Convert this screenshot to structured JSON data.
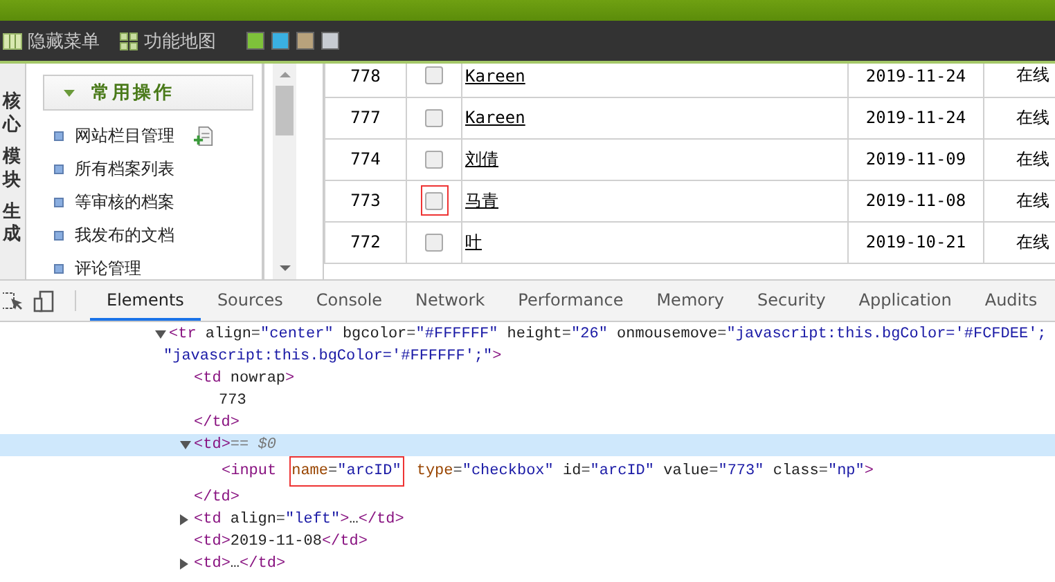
{
  "toolbar": {
    "items": [
      {
        "label": "隐藏菜单",
        "kind": "columns"
      },
      {
        "label": "功能地图",
        "kind": "grid"
      }
    ],
    "swatches": [
      {
        "color": "#7ec23a"
      },
      {
        "color": "#3ab0e2"
      },
      {
        "color": "#b8a27c"
      },
      {
        "color": "#c8ccd2"
      }
    ]
  },
  "side_tabs": [
    "核心",
    "模块",
    "生成"
  ],
  "sidebar": {
    "header": "常用操作",
    "expanded": true,
    "items": [
      {
        "label": "网站栏目管理",
        "has_add": true
      },
      {
        "label": "所有档案列表",
        "has_add": false
      },
      {
        "label": "等审核的档案",
        "has_add": false
      },
      {
        "label": "我发布的文档",
        "has_add": false
      },
      {
        "label": "评论管理",
        "has_add": false
      }
    ]
  },
  "table": {
    "rows": [
      {
        "id": "778",
        "checked": false,
        "highlighted": false,
        "title": "Kareen",
        "date": "2019-11-24",
        "status": "在线"
      },
      {
        "id": "777",
        "checked": false,
        "highlighted": false,
        "title": "Kareen",
        "date": "2019-11-24",
        "status": "在线"
      },
      {
        "id": "774",
        "checked": false,
        "highlighted": false,
        "title": "刘倩",
        "date": "2019-11-09",
        "status": "在线"
      },
      {
        "id": "773",
        "checked": false,
        "highlighted": true,
        "title": "马青",
        "date": "2019-11-08",
        "status": "在线"
      },
      {
        "id": "772",
        "checked": false,
        "highlighted": false,
        "title": "叶",
        "date": "2019-10-21",
        "status": "在线"
      }
    ]
  },
  "devtools": {
    "tabs": [
      {
        "label": "Elements",
        "selected": true
      },
      {
        "label": "Sources",
        "selected": false
      },
      {
        "label": "Console",
        "selected": false
      },
      {
        "label": "Network",
        "selected": false
      },
      {
        "label": "Performance",
        "selected": false
      },
      {
        "label": "Memory",
        "selected": false
      },
      {
        "label": "Security",
        "selected": false
      },
      {
        "label": "Application",
        "selected": false
      },
      {
        "label": "Audits",
        "selected": false
      }
    ],
    "tree": [
      {
        "lines": [
          "<tr align=\"center\" bgcolor=\"#FFFFFF\" height=\"26\" onmousemove=\"javascript:this.bgColor='#FCFDEE';",
          "\"javascript:this.bgColor='#FFFFFF';\">"
        ],
        "expanded": true,
        "selected": false,
        "children": [
          {
            "lines": [
              "<td nowrap>"
            ],
            "selected": false,
            "children": [
              {
                "lines": [
                  "773"
                ],
                "selected": false
              }
            ],
            "close": "</td>"
          },
          {
            "lines": [
              "<td>"
            ],
            "suffix": "== $0",
            "expanded": true,
            "selected": true,
            "children": [
              {
                "segments": [
                  {
                    "text": "<input",
                    "boxed": false
                  },
                  {
                    "text": "name=\"arcID\"",
                    "boxed": true
                  },
                  {
                    "text": "type=\"checkbox\" id=\"arcID\" value=\"773\" class=\"np\">",
                    "boxed": false
                  }
                ],
                "selected": false
              }
            ],
            "close": "</td>"
          },
          {
            "lines": [
              "<td align=\"left\">…</td>"
            ],
            "expanded": false,
            "selected": false
          },
          {
            "lines": [
              "<td>2019-11-08</td>"
            ],
            "selected": false
          },
          {
            "lines": [
              "<td>…</td>"
            ],
            "expanded": false,
            "selected": false
          }
        ]
      }
    ]
  }
}
